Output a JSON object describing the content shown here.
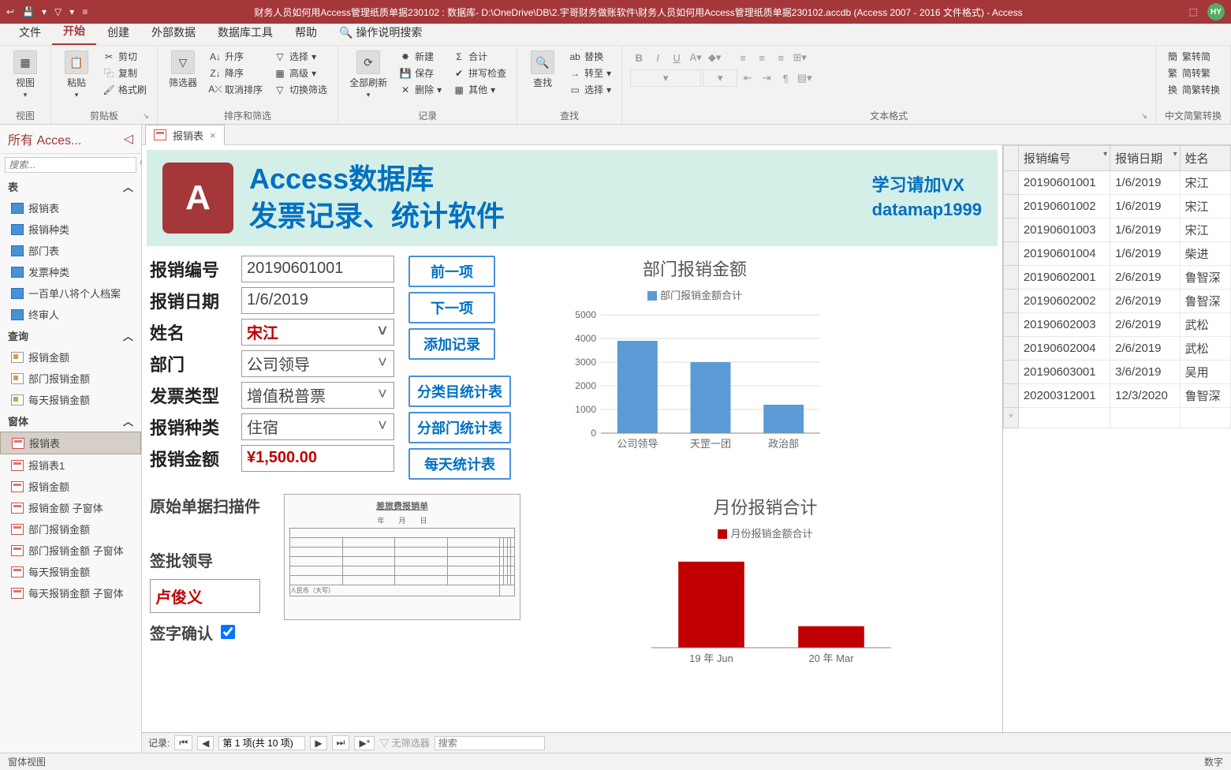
{
  "titlebar": {
    "title": "财务人员如何用Access管理纸质单据230102 : 数据库- D:\\OneDrive\\DB\\2.宇哥财务做账软件\\财务人员如何用Access管理纸质单据230102.accdb (Access 2007 - 2016 文件格式)  -  Access",
    "user": "HY"
  },
  "menu": {
    "tabs": [
      "文件",
      "开始",
      "创建",
      "外部数据",
      "数据库工具",
      "帮助"
    ],
    "active": "开始",
    "tell_me": "操作说明搜索"
  },
  "ribbon": {
    "view": {
      "label": "视图",
      "group": "视图"
    },
    "clipboard": {
      "paste": "粘贴",
      "cut": "剪切",
      "copy": "复制",
      "format": "格式刷",
      "group": "剪贴板"
    },
    "sort": {
      "filter": "筛选器",
      "asc": "升序",
      "desc": "降序",
      "remove": "取消排序",
      "sel": "选择",
      "adv": "高级",
      "toggle": "切换筛选",
      "group": "排序和筛选"
    },
    "records": {
      "refresh": "全部刷新",
      "new": "新建",
      "save": "保存",
      "delete": "删除",
      "totals": "合计",
      "spell": "拼写检查",
      "more": "其他",
      "group": "记录"
    },
    "find": {
      "find": "查找",
      "replace": "替换",
      "goto": "转至",
      "select": "选择",
      "group": "查找"
    },
    "text": {
      "group": "文本格式"
    },
    "chinese": {
      "s2t": "繁转简",
      "t2s": "简转繁",
      "conv": "简繁转换",
      "group": "中文简繁转换"
    }
  },
  "nav": {
    "title": "所有 Acces...",
    "search": "搜索...",
    "sections": {
      "tables": {
        "label": "表",
        "items": [
          "报销表",
          "报销种类",
          "部门表",
          "发票种类",
          "一百单八将个人档案",
          "终审人"
        ]
      },
      "queries": {
        "label": "查询",
        "items": [
          "报销金额",
          "部门报销金额",
          "每天报销金额"
        ]
      },
      "forms": {
        "label": "窗体",
        "items": [
          "报销表",
          "报销表1",
          "报销金额",
          "报销金额 子窗体",
          "部门报销金额",
          "部门报销金额 子窗体",
          "每天报销金额",
          "每天报销金额 子窗体"
        ],
        "selected": "报销表"
      }
    }
  },
  "doc": {
    "tab": "报销表",
    "banner": {
      "line1": "Access数据库",
      "line2": "发票记录、统计软件",
      "side1": "学习请加VX",
      "side2": "datamap1999"
    },
    "fields": {
      "id_label": "报销编号",
      "id": "20190601001",
      "date_label": "报销日期",
      "date": "1/6/2019",
      "name_label": "姓名",
      "name": "宋江",
      "dept_label": "部门",
      "dept": "公司领导",
      "invoice_label": "发票类型",
      "invoice": "增值税普票",
      "kind_label": "报销种类",
      "kind": "住宿",
      "amount_label": "报销金额",
      "amount": "¥1,500.00",
      "scan_label": "原始单据扫描件",
      "leader_label": "签批领导",
      "leader": "卢俊义",
      "confirm_label": "签字确认"
    },
    "buttons": {
      "prev": "前一项",
      "next": "下一项",
      "add": "添加记录",
      "cat": "分类目统计表",
      "dept": "分部门统计表",
      "day": "每天统计表"
    },
    "scan_title": "差旅费报销单",
    "chart1": {
      "title": "部门报销金额",
      "legend": "部门报销金额合计"
    },
    "chart2": {
      "title": "月份报销合计",
      "legend": "月份报销金额合计"
    }
  },
  "chart_data": [
    {
      "type": "bar",
      "title": "部门报销金额",
      "legend": "部门报销金额合计",
      "categories": [
        "公司领导",
        "天罡一团",
        "政治部"
      ],
      "values": [
        3900,
        3000,
        1200
      ],
      "ylim": [
        0,
        5000
      ],
      "yticks": [
        0,
        1000,
        2000,
        3000,
        4000,
        5000
      ],
      "color": "#5b9bd5"
    },
    {
      "type": "bar",
      "title": "月份报销合计",
      "legend": "月份报销金额合计",
      "categories": [
        "19 年 Jun",
        "20 年 Mar"
      ],
      "values": [
        100,
        25
      ],
      "ylim": [
        0,
        110
      ],
      "color": "#c00000"
    }
  ],
  "datasheet": {
    "columns": [
      "报销编号",
      "报销日期",
      "姓名"
    ],
    "rows": [
      [
        "20190601001",
        "1/6/2019",
        "宋江"
      ],
      [
        "20190601002",
        "1/6/2019",
        "宋江"
      ],
      [
        "20190601003",
        "1/6/2019",
        "宋江"
      ],
      [
        "20190601004",
        "1/6/2019",
        "柴进"
      ],
      [
        "20190602001",
        "2/6/2019",
        "鲁智深"
      ],
      [
        "20190602002",
        "2/6/2019",
        "鲁智深"
      ],
      [
        "20190602003",
        "2/6/2019",
        "武松"
      ],
      [
        "20190602004",
        "2/6/2019",
        "武松"
      ],
      [
        "20190603001",
        "3/6/2019",
        "吴用"
      ],
      [
        "20200312001",
        "12/3/2020",
        "鲁智深"
      ]
    ]
  },
  "recordnav": {
    "label": "记录:",
    "pos": "第 1 项(共 10 项)",
    "nofilter": "无筛选器",
    "search": "搜索"
  },
  "status": {
    "left": "窗体视图",
    "right": "数字"
  }
}
